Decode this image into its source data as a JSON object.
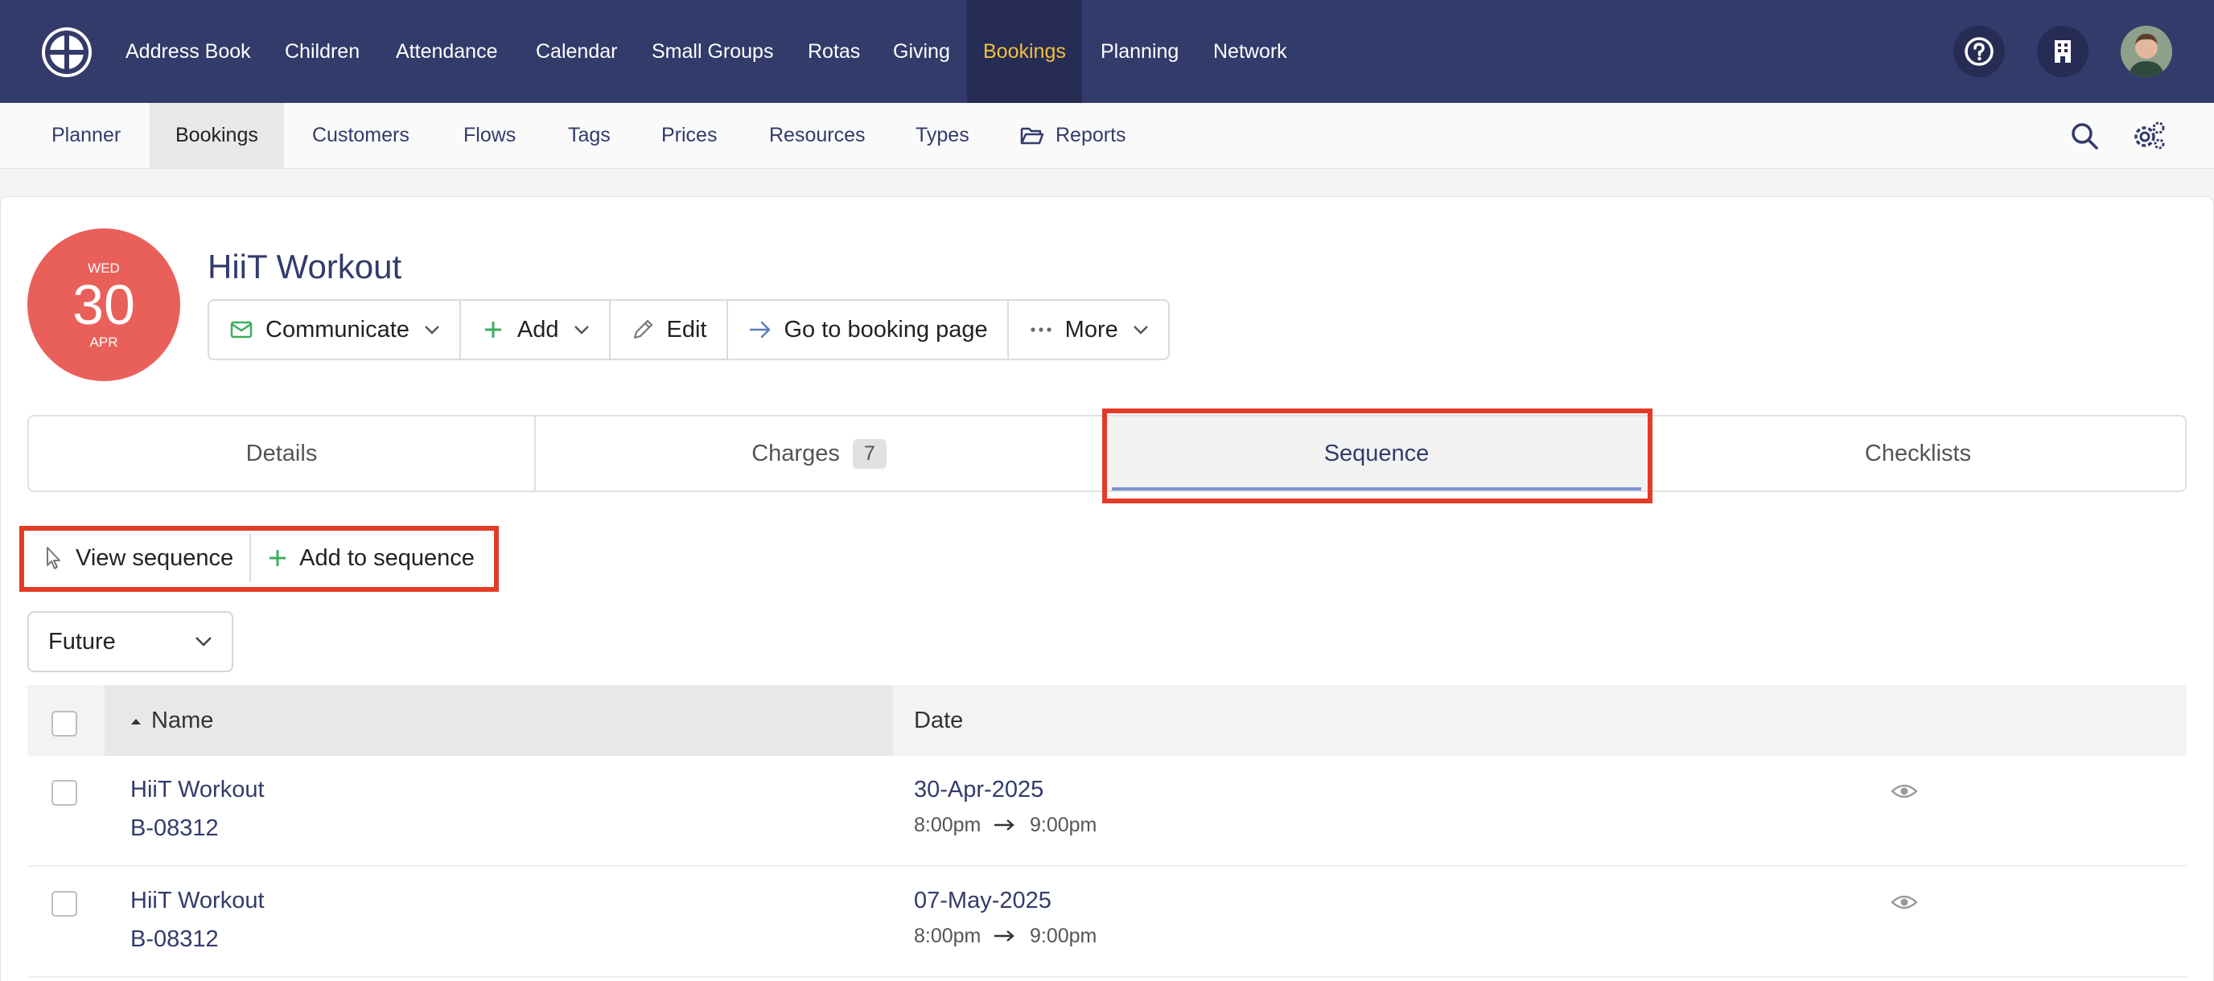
{
  "topnav": {
    "items": [
      {
        "label": "Address Book"
      },
      {
        "label": "Children"
      },
      {
        "label": "Attendance"
      },
      {
        "label": "Calendar"
      },
      {
        "label": "Small Groups"
      },
      {
        "label": "Rotas"
      },
      {
        "label": "Giving"
      },
      {
        "label": "Bookings"
      },
      {
        "label": "Planning"
      },
      {
        "label": "Network"
      }
    ],
    "active": "Bookings",
    "active_color": "#f3bf3d",
    "bg_color": "#333b6b"
  },
  "subnav": {
    "items": [
      {
        "label": "Planner"
      },
      {
        "label": "Bookings"
      },
      {
        "label": "Customers"
      },
      {
        "label": "Flows"
      },
      {
        "label": "Tags"
      },
      {
        "label": "Prices"
      },
      {
        "label": "Resources"
      },
      {
        "label": "Types"
      },
      {
        "label": "Reports"
      }
    ],
    "active": "Bookings"
  },
  "event": {
    "dow": "WED",
    "day": "30",
    "month": "APR",
    "title": "HiiT Workout",
    "accent": "#e9605a"
  },
  "actions": {
    "communicate": "Communicate",
    "add": "Add",
    "edit": "Edit",
    "goto": "Go to booking page",
    "more": "More"
  },
  "tabs": {
    "details": "Details",
    "charges": "Charges",
    "charges_count": "7",
    "sequence": "Sequence",
    "checklists": "Checklists",
    "active": "Sequence"
  },
  "sequence_actions": {
    "view": "View sequence",
    "add": "Add to sequence"
  },
  "filter": {
    "selected": "Future"
  },
  "table": {
    "headers": {
      "name": "Name",
      "date": "Date"
    },
    "rows": [
      {
        "name": "HiiT Workout",
        "ref": "B-08312",
        "date": "30-Apr-2025",
        "start": "8:00pm",
        "end": "9:00pm"
      },
      {
        "name": "HiiT Workout",
        "ref": "B-08312",
        "date": "07-May-2025",
        "start": "8:00pm",
        "end": "9:00pm"
      }
    ]
  },
  "highlight_color": "#e33b26"
}
